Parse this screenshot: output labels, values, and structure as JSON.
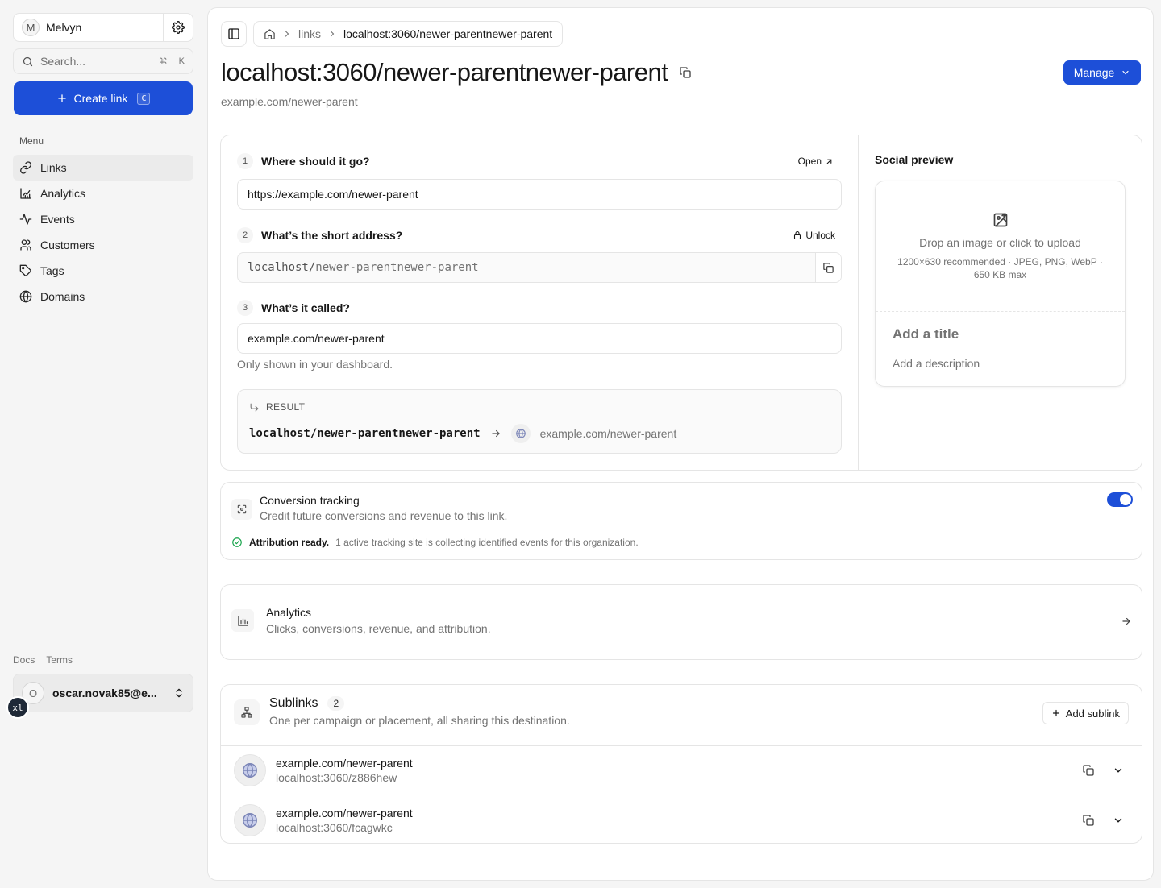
{
  "org": {
    "initial": "M",
    "name": "Melvyn"
  },
  "search": {
    "placeholder": "Search...",
    "shortcut_cmd": "⌘",
    "shortcut_key": "K"
  },
  "create_button": {
    "label": "Create link",
    "shortcut": "C"
  },
  "menu": {
    "label": "Menu",
    "items": [
      {
        "label": "Links",
        "icon": "link-icon",
        "active": true
      },
      {
        "label": "Analytics",
        "icon": "chart-icon",
        "active": false
      },
      {
        "label": "Events",
        "icon": "activity-icon",
        "active": false
      },
      {
        "label": "Customers",
        "icon": "users-icon",
        "active": false
      },
      {
        "label": "Tags",
        "icon": "tag-icon",
        "active": false
      },
      {
        "label": "Domains",
        "icon": "globe-icon",
        "active": false
      }
    ]
  },
  "footer": {
    "docs": "Docs",
    "terms": "Terms"
  },
  "user": {
    "initial": "O",
    "email": "oscar.novak85@e..."
  },
  "dev_badge": "xl",
  "breadcrumb": {
    "parent": "links",
    "current": "localhost:3060/newer-parentnewer-parent"
  },
  "page": {
    "title": "localhost:3060/newer-parentnewer-parent",
    "subtitle": "example.com/newer-parent",
    "manage_label": "Manage"
  },
  "form": {
    "step1": {
      "num": "1",
      "label": "Where should it go?",
      "action": "Open",
      "value": "https://example.com/newer-parent"
    },
    "step2": {
      "num": "2",
      "label": "What’s the short address?",
      "action": "Unlock",
      "prefix": "localhost/",
      "path": "newer-parentnewer-parent"
    },
    "step3": {
      "num": "3",
      "label": "What’s it called?",
      "value": "example.com/newer-parent",
      "hint": "Only shown in your dashboard."
    },
    "result": {
      "label": "RESULT",
      "short": "localhost/newer-parentnewer-parent",
      "destination": "example.com/newer-parent"
    }
  },
  "social": {
    "title": "Social preview",
    "upload_text": "Drop an image or click to upload",
    "upload_spec": "1200×630 recommended · JPEG, PNG, WebP · 650 KB max",
    "add_title": "Add a title",
    "add_description": "Add a description"
  },
  "conversion": {
    "title": "Conversion tracking",
    "description": "Credit future conversions and revenue to this link.",
    "enabled": true,
    "status_strong": "Attribution ready.",
    "status_text": "1 active tracking site is collecting identified events for this organization."
  },
  "analytics": {
    "title": "Analytics",
    "description": "Clicks, conversions, revenue, and attribution."
  },
  "sublinks": {
    "title": "Sublinks",
    "count": "2",
    "description": "One per campaign or placement, all sharing this destination.",
    "add_label": "Add sublink",
    "items": [
      {
        "destination": "example.com/newer-parent",
        "short": "localhost:3060/z886hew"
      },
      {
        "destination": "example.com/newer-parent",
        "short": "localhost:3060/fcagwkc"
      }
    ]
  },
  "colors": {
    "accent": "#1d4fd8",
    "border": "#e5e5e5",
    "muted": "#737373"
  }
}
